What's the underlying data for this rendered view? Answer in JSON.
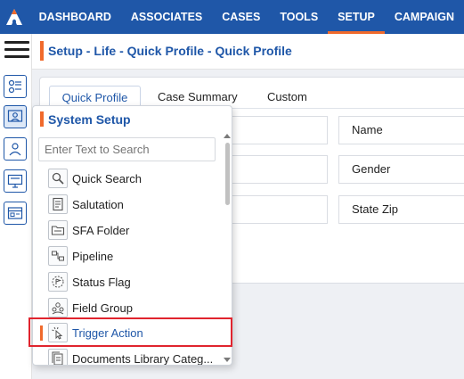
{
  "nav": {
    "items": [
      {
        "label": "DASHBOARD",
        "active": false
      },
      {
        "label": "ASSOCIATES",
        "active": false
      },
      {
        "label": "CASES",
        "active": false
      },
      {
        "label": "TOOLS",
        "active": false
      },
      {
        "label": "SETUP",
        "active": true
      },
      {
        "label": "CAMPAIGN",
        "active": false
      }
    ]
  },
  "header": {
    "title": "Setup - Life - Quick Profile - Quick Profile"
  },
  "tabs": [
    {
      "label": "Quick Profile",
      "active": true
    },
    {
      "label": "Case Summary",
      "active": false
    },
    {
      "label": "Custom",
      "active": false
    }
  ],
  "fields": {
    "name": "Name",
    "gender": "Gender",
    "state_zip": "State Zip"
  },
  "flyout": {
    "title": "System Setup",
    "search_placeholder": "Enter Text to Search",
    "items": [
      {
        "label": "Quick Search",
        "icon": "magnifier-icon"
      },
      {
        "label": "Salutation",
        "icon": "document-icon"
      },
      {
        "label": "SFA Folder",
        "icon": "folder-icon"
      },
      {
        "label": "Pipeline",
        "icon": "pipeline-icon"
      },
      {
        "label": "Status Flag",
        "icon": "status-flag-icon"
      },
      {
        "label": "Field Group",
        "icon": "field-group-icon"
      },
      {
        "label": "Trigger Action",
        "icon": "trigger-icon",
        "selected": true
      },
      {
        "label": "Documents Library Categ...",
        "icon": "documents-icon"
      }
    ]
  },
  "colors": {
    "brand": "#1f57a8",
    "accent": "#f06a2c",
    "highlight": "#e0242e"
  }
}
